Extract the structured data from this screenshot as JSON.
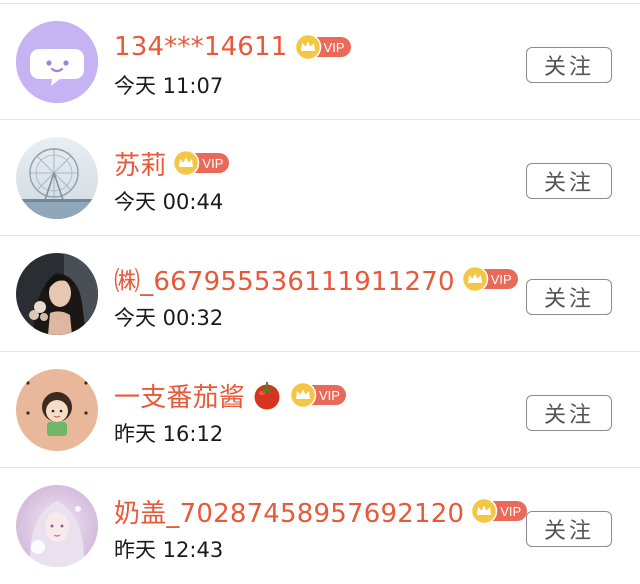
{
  "follow_list": {
    "vip_badge": "VIP",
    "rows": [
      {
        "username": "134***14611",
        "time": "今天 11:07",
        "follow_label": "关注"
      },
      {
        "username": "苏莉",
        "time": "今天 00:44",
        "follow_label": "关注"
      },
      {
        "username": "㈱_667955536111911270",
        "time": "今天 00:32",
        "follow_label": "关注"
      },
      {
        "username": "一支番茄酱",
        "time": "昨天 16:12",
        "follow_label": "关注",
        "emoji": "tomato-emoji"
      },
      {
        "username": "奶盖_70287458957692120",
        "time": "昨天 12:43",
        "follow_label": "关注"
      }
    ]
  },
  "colors": {
    "username": "#e8593a",
    "vip_badge": "#ea6a5a",
    "crown": "#f2b632",
    "follow_border": "#8c8c8c",
    "avatar_default": "#c6b3f3"
  },
  "icons": [
    "chat-bubble-avatar-icon",
    "crown-icon",
    "tomato-emoji"
  ]
}
